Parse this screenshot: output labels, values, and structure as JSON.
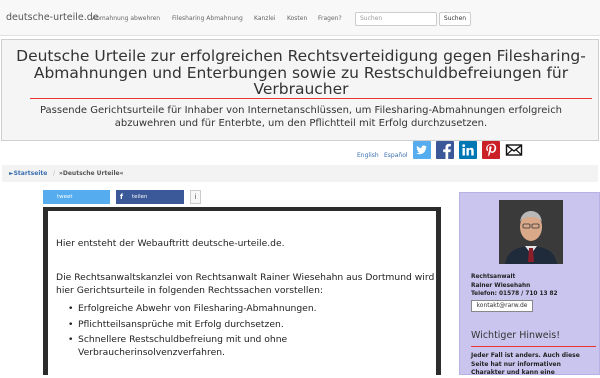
{
  "navbar": {
    "brand": "deutsche-urteile.de",
    "links": [
      "Abmahnung abwehren",
      "Filesharing Abmahnung",
      "Kanzlei",
      "Kosten",
      "Fragen?"
    ],
    "search_placeholder": "Suchen",
    "search_button": "Suchen"
  },
  "header": {
    "title": "Deutsche Urteile zur erfolgreichen Rechtsverteidigung gegen Filesharing-Abmahnungen und Enterbungen sowie zu Restschuldbefreiungen für Verbraucher",
    "subtitle": "Passende Gerichtsurteile für Inhaber von Internetanschlüssen, um Filesharing-Abmahnungen erfolgreich abzuwehren und für Enterbte, um den Pflichtteil mit Erfolg durchzusetzen."
  },
  "languages": [
    "English",
    "Español"
  ],
  "social_icons": [
    "twitter-icon",
    "facebook-icon",
    "linkedin-icon",
    "pinterest-icon",
    "email-icon"
  ],
  "breadcrumb": {
    "home": "►Startseite",
    "separator": "/",
    "current": "»Deutsche Urteile«"
  },
  "share_bar": {
    "tweet": "tweet",
    "share": "teilen",
    "info": "i"
  },
  "content": {
    "intro": "Hier entsteht der Webauftritt deutsche-urteile.de.",
    "paragraph": "Die Rechtsanwaltskanzlei von Rechtsanwalt Rainer Wiesehahn aus Dortmund wird hier Gerichtsurteile in folgenden Rechtssachen vorstellen:",
    "items": [
      "Erfolgreiche Abwehr von Filesharing-Abmahnungen.",
      "Pflichtteilsansprüche mit Erfolg durchsetzen.",
      "Schnellere Restschuldbefreiung mit und ohne Verbraucherinsolvenzverfahren."
    ]
  },
  "sidebar": {
    "role": "Rechtsanwalt",
    "name": "Rainer Wiesehahn",
    "phone": "Telefon: 01578 / 710 13 82",
    "email": "kontakt@rarw.de",
    "hint_title": "Wichtiger Hinweis!",
    "hint_text": "Jeder Fall ist anders. Auch diese Seite hat nur informativen Charakter und kann eine"
  },
  "colors": {
    "twitter": "#55acee",
    "facebook": "#3b5998",
    "linkedin": "#0077b5",
    "pinterest": "#cb2027",
    "sidebar_bg": "#c9c5ee",
    "accent_rule": "#ee3333"
  }
}
